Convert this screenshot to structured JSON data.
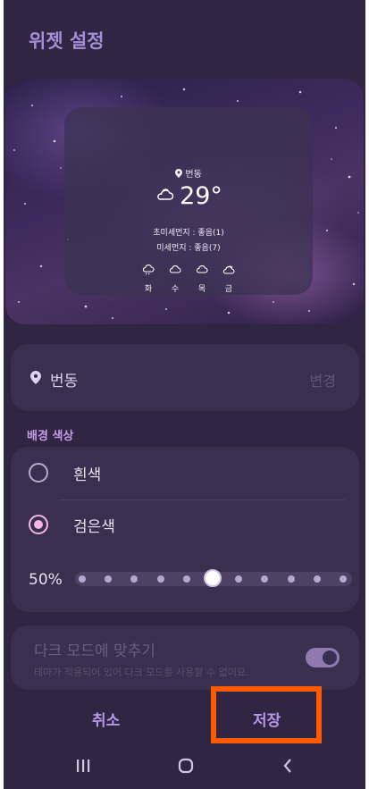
{
  "header": {
    "title": "위젯 설정"
  },
  "preview": {
    "location": "번동",
    "temperature": "29°",
    "fine_dust": "초미세먼지 : 좋음(1)",
    "dust": "미세먼지 : 좋음(7)",
    "forecast": [
      {
        "day": "화",
        "icon": "rain-cloud-icon"
      },
      {
        "day": "수",
        "icon": "cloud-icon"
      },
      {
        "day": "목",
        "icon": "cloud-icon"
      },
      {
        "day": "금",
        "icon": "partly-cloudy-icon"
      }
    ]
  },
  "location_card": {
    "name": "번동",
    "change_label": "변경"
  },
  "background": {
    "section_title": "배경 색상",
    "options": [
      {
        "label": "흰색",
        "selected": false
      },
      {
        "label": "검은색",
        "selected": true
      }
    ],
    "transparency_label": "50%",
    "transparency_value": 0.5
  },
  "dark_mode": {
    "title": "다크 모드에 맞추기",
    "subtitle": "테마가 적용되어 있어 다크 모드를 사용할 수 없어요.",
    "enabled": true
  },
  "actions": {
    "cancel_label": "취소",
    "save_label": "저장"
  },
  "navbar": {
    "icons": [
      "recents-icon",
      "home-icon",
      "back-icon"
    ]
  },
  "colors": {
    "background": "#302542",
    "accent": "#b697e8",
    "highlight": "#ff5a00"
  }
}
